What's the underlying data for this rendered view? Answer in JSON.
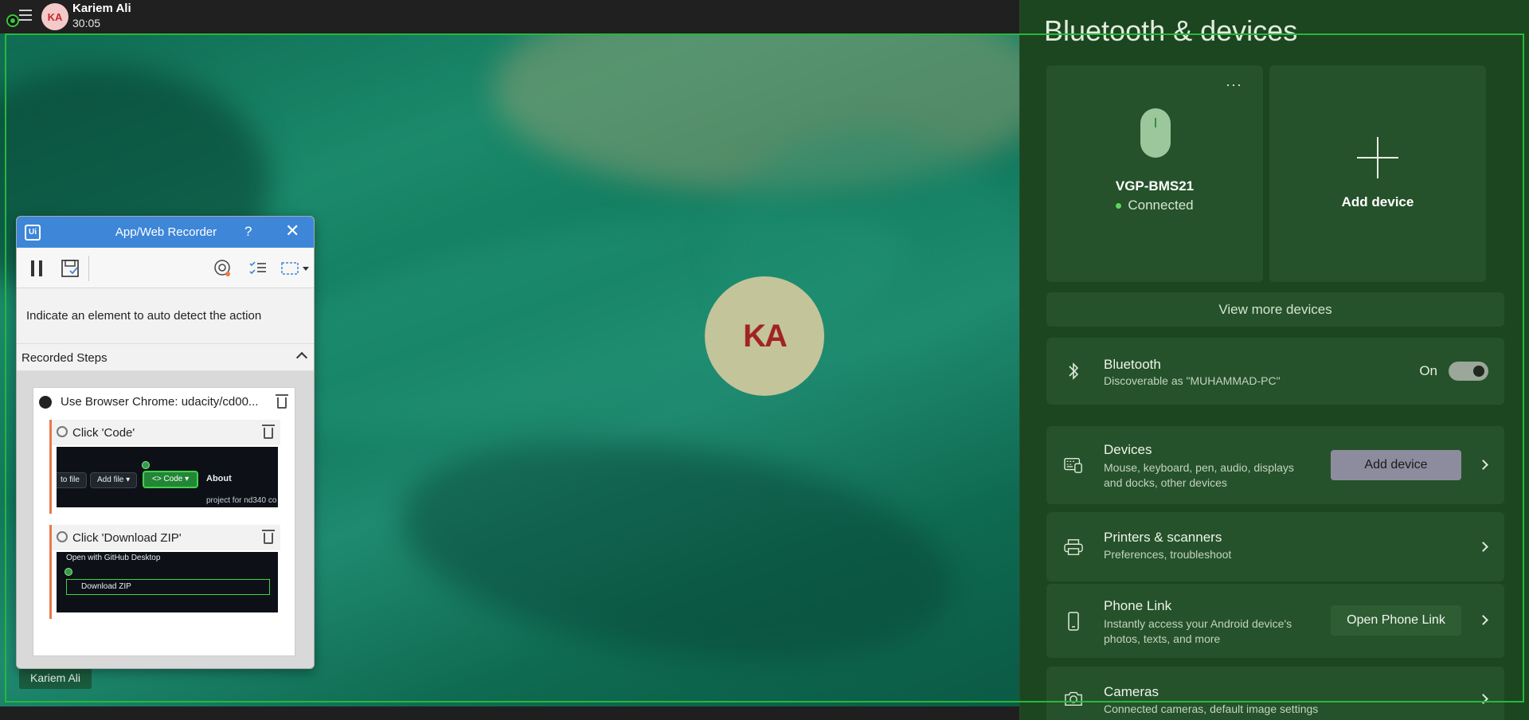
{
  "meeting": {
    "user_name": "Kariem Ali",
    "timer": "30:05",
    "avatar_initials": "KA",
    "center_initials": "KA",
    "name_tag": "Kariem Ali"
  },
  "settings": {
    "title": "Bluetooth & devices",
    "device_card": {
      "name": "VGP-BMS21",
      "status": "Connected",
      "more_label": "···"
    },
    "add_card": {
      "label": "Add device"
    },
    "view_more": "View more devices",
    "rows": [
      {
        "title": "Bluetooth",
        "subtitle": "Discoverable as \"MUHAMMAD-PC\"",
        "toggle_label": "On"
      },
      {
        "title": "Devices",
        "subtitle": "Mouse, keyboard, pen, audio, displays and docks, other devices",
        "button": "Add device"
      },
      {
        "title": "Printers & scanners",
        "subtitle": "Preferences, troubleshoot"
      },
      {
        "title": "Phone Link",
        "subtitle": "Instantly access your Android device's photos, texts, and more",
        "button": "Open Phone Link"
      },
      {
        "title": "Cameras",
        "subtitle": "Connected cameras, default image settings"
      }
    ]
  },
  "recorder": {
    "title": "App/Web Recorder",
    "help": "?",
    "logo": "Ui",
    "instruction": "Indicate an element to auto detect the action",
    "steps_header": "Recorded Steps",
    "browser_step": "Use Browser Chrome: udacity/cd00...",
    "steps": [
      {
        "label": "Click 'Code'",
        "thumb": {
          "to_file": "to file",
          "add_file": "Add file ▾",
          "code": "<> Code ▾",
          "about": "About",
          "project": "project for nd340 co"
        }
      },
      {
        "label": "Click 'Download ZIP'",
        "thumb": {
          "open_gh": "Open with GitHub Desktop",
          "download": "Download ZIP"
        }
      }
    ]
  },
  "colors": {
    "accent_green": "#27b83a",
    "recorder_blue": "#3d86d8",
    "settings_bg": "#1c4620"
  }
}
